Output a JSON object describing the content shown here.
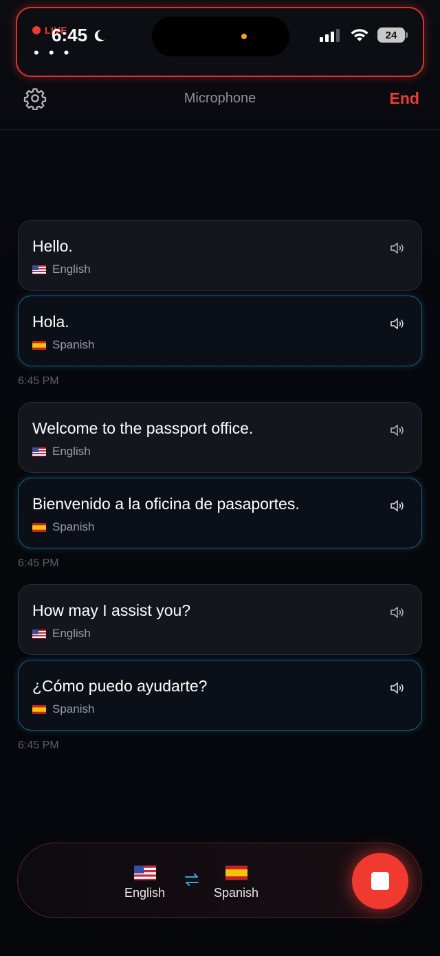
{
  "status_bar": {
    "live": "LIVE",
    "time": "6:45",
    "menu": "• • •",
    "battery": "24"
  },
  "header": {
    "title": "Microphone",
    "end": "End"
  },
  "conversation": [
    {
      "original": {
        "text": "Hello.",
        "language": "English"
      },
      "translation": {
        "text": "Hola.",
        "language": "Spanish"
      },
      "time": "6:45 PM"
    },
    {
      "original": {
        "text": "Welcome to the passport office.",
        "language": "English"
      },
      "translation": {
        "text": "Bienvenido a la oficina de pasaportes.",
        "language": "Spanish"
      },
      "time": "6:45 PM"
    },
    {
      "original": {
        "text": "How may I assist you?",
        "language": "English"
      },
      "translation": {
        "text": "¿Cómo puedo ayudarte?",
        "language": "Spanish"
      },
      "time": "6:45 PM"
    }
  ],
  "bottom_bar": {
    "source_language": "English",
    "target_language": "Spanish"
  },
  "icons": {
    "settings": "gear-icon",
    "speaker": "speaker-icon",
    "swap": "swap-arrows-icon",
    "stop": "stop-icon"
  },
  "colors": {
    "accent_red": "#ee3b34",
    "swap_blue": "#2ea9e0",
    "translation_border": "#1d5f7a"
  }
}
